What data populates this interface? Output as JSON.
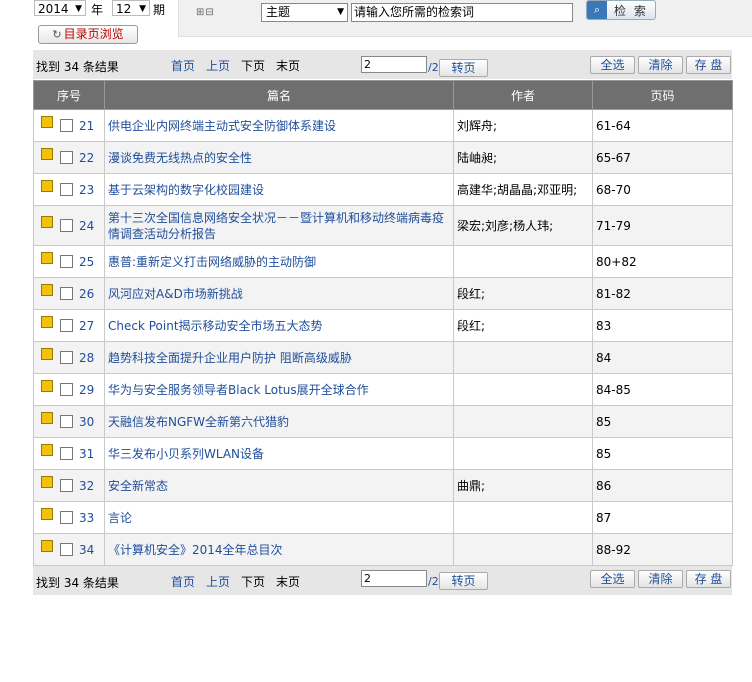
{
  "filter": {
    "year": "2014",
    "year_label": "年",
    "issue": "12",
    "issue_label": "期",
    "browse_label": "目录页浏览",
    "search_field": "主题",
    "keyword_placeholder": "请输入您所需的检索词",
    "search_label": "检 索"
  },
  "pager": {
    "found": "找到 34 条结果",
    "first": "首页",
    "prev": "上页",
    "next": "下页",
    "last": "末页",
    "page": "2",
    "total": "/2",
    "go": "转页",
    "select_all": "全选",
    "clear": "清除",
    "save": "存 盘"
  },
  "table": {
    "headers": [
      "序号",
      "篇名",
      "作者",
      "页码"
    ],
    "rows": [
      {
        "num": "21",
        "title": "供电企业内网终端主动式安全防御体系建设",
        "author": "刘辉舟;",
        "pages": "61-64"
      },
      {
        "num": "22",
        "title": "漫谈免费无线热点的安全性",
        "author": "陆岫昶;",
        "pages": "65-67"
      },
      {
        "num": "23",
        "title": "基于云架构的数字化校园建设",
        "author": "高建华;胡晶晶;邓亚明;",
        "pages": "68-70"
      },
      {
        "num": "24",
        "title": "第十三次全国信息网络安全状况－－暨计算机和移动终端病毒疫情调查活动分析报告",
        "author": "梁宏;刘彦;杨人玮;",
        "pages": "71-79"
      },
      {
        "num": "25",
        "title": "惠普:重新定义打击网络威胁的主动防御",
        "author": "",
        "pages": "80+82"
      },
      {
        "num": "26",
        "title": "风河应对A&D市场新挑战",
        "author": "段红;",
        "pages": "81-82"
      },
      {
        "num": "27",
        "title": "Check Point揭示移动安全市场五大态势",
        "author": "段红;",
        "pages": "83"
      },
      {
        "num": "28",
        "title": "趋势科技全面提升企业用户防护 阻断高级威胁",
        "author": "",
        "pages": "84"
      },
      {
        "num": "29",
        "title": "华为与安全服务领导者Black Lotus展开全球合作",
        "author": "",
        "pages": "84-85"
      },
      {
        "num": "30",
        "title": "天融信发布NGFW全新第六代猎豹",
        "author": "",
        "pages": "85"
      },
      {
        "num": "31",
        "title": "华三发布小贝系列WLAN设备",
        "author": "",
        "pages": "85"
      },
      {
        "num": "32",
        "title": "安全新常态",
        "author": "曲鼎;",
        "pages": "86"
      },
      {
        "num": "33",
        "title": "言论",
        "author": "",
        "pages": "87"
      },
      {
        "num": "34",
        "title": "《计算机安全》2014全年总目次",
        "author": "",
        "pages": "88-92"
      }
    ]
  }
}
